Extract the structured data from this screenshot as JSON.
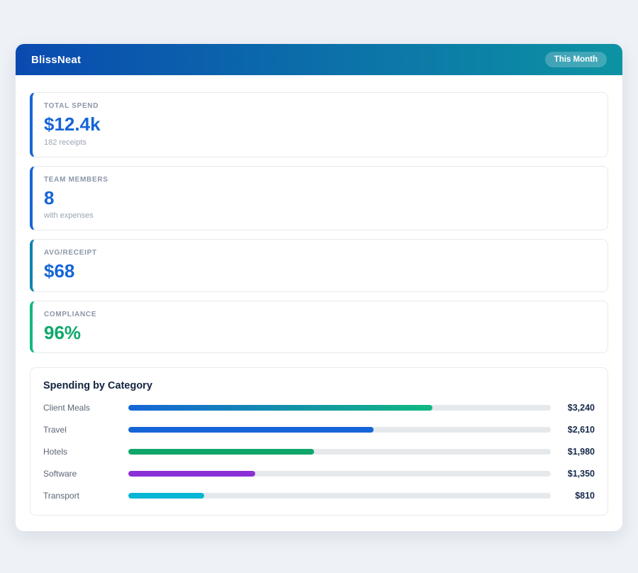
{
  "header": {
    "app_name": "BlissNeat",
    "period_badge": "This Month"
  },
  "stats": [
    {
      "label": "TOTAL SPEND",
      "value": "$12.4k",
      "sub": "182 receipts",
      "accent": "#1565d8",
      "value_color": "#1565d8"
    },
    {
      "label": "TEAM MEMBERS",
      "value": "8",
      "sub": "with expenses",
      "accent": "#1565d8",
      "value_color": "#1565d8"
    },
    {
      "label": "AVG/RECEIPT",
      "value": "$68",
      "sub": "",
      "accent": "#0d85ab",
      "value_color": "#1565d8"
    },
    {
      "label": "COMPLIANCE",
      "value": "96%",
      "sub": "",
      "accent": "#10b981",
      "value_color": "#0ea86b"
    }
  ],
  "chart_data": {
    "type": "bar",
    "orientation": "horizontal",
    "title": "Spending by Category",
    "categories": [
      "Client Meals",
      "Travel",
      "Hotels",
      "Software",
      "Transport"
    ],
    "values": [
      3240,
      2610,
      1980,
      1350,
      810
    ],
    "value_labels": [
      "$3,240",
      "$2,610",
      "$1,980",
      "$1,350",
      "$810"
    ],
    "xlim": [
      0,
      4500
    ],
    "grid": false,
    "bar_colors": [
      "linear-gradient(90deg, #1565d8, #10b981)",
      "#1565d8",
      "#10a56a",
      "#8b2fd6",
      "#06b6d4"
    ],
    "track_color": "#e6e9ec"
  }
}
